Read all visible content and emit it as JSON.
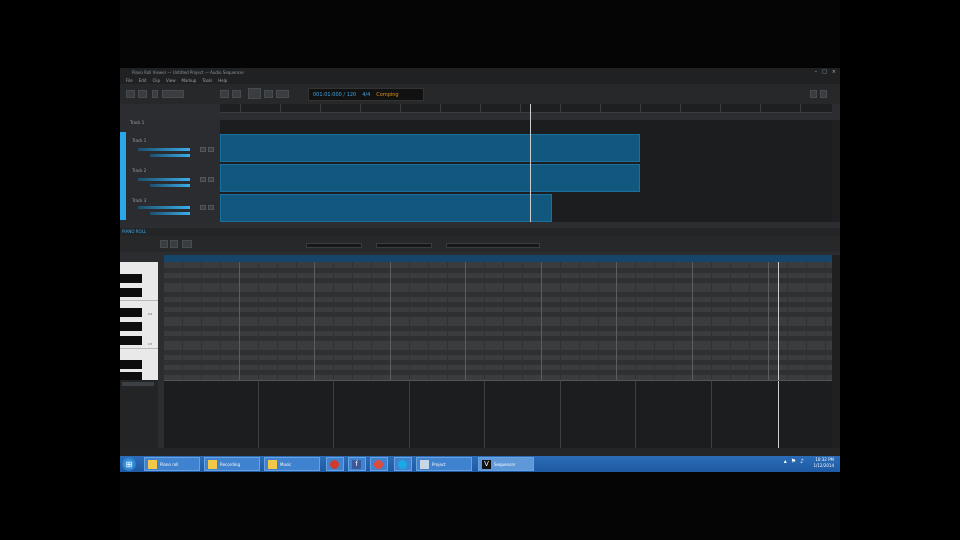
{
  "window": {
    "title": "Piano Roll Viewer — Untitled Project — Audio Sequencer",
    "controls": [
      "–",
      "□",
      "×"
    ]
  },
  "menu": [
    "File",
    "Edit",
    "Clip",
    "View",
    "Markup",
    "Tools",
    "Help"
  ],
  "toolbar": {
    "transport_readout": "001:01:000 / 120",
    "transport_mode": "4/4",
    "transport_status": "Comping"
  },
  "tracks": {
    "header_label": "Track 1",
    "items": [
      {
        "name": "Track 1",
        "fader_value": 0.85
      },
      {
        "name": "Track 2",
        "fader_value": 0.7
      },
      {
        "name": "Track 3",
        "fader_value": 0.8
      }
    ]
  },
  "piano_roll": {
    "panel_label": "PIANO ROLL",
    "fields": [
      "",
      "",
      ""
    ],
    "key_labels": [
      "C4",
      "C3"
    ]
  },
  "colors": {
    "accent": "#28a8e8",
    "clip_fill": "#11577e",
    "grid_bg": "#3a3c3e",
    "taskbar": "#1f5aa3"
  },
  "taskbar": {
    "items": [
      {
        "label": "Piano roll",
        "icon": "explorer-icon"
      },
      {
        "label": "Recording",
        "icon": "folder-icon"
      },
      {
        "label": "Music",
        "icon": "folder-icon"
      },
      {
        "label": "",
        "icon": "opera-icon"
      },
      {
        "label": "",
        "icon": "facebook-icon"
      },
      {
        "label": "",
        "icon": "chrome-icon"
      },
      {
        "label": "",
        "icon": "skype-icon"
      },
      {
        "label": "Project",
        "icon": "window-icon"
      },
      {
        "label": "Sequencer",
        "icon": "app-icon"
      }
    ],
    "clock_time": "10:32 PM",
    "clock_date": "1/12/2014"
  }
}
